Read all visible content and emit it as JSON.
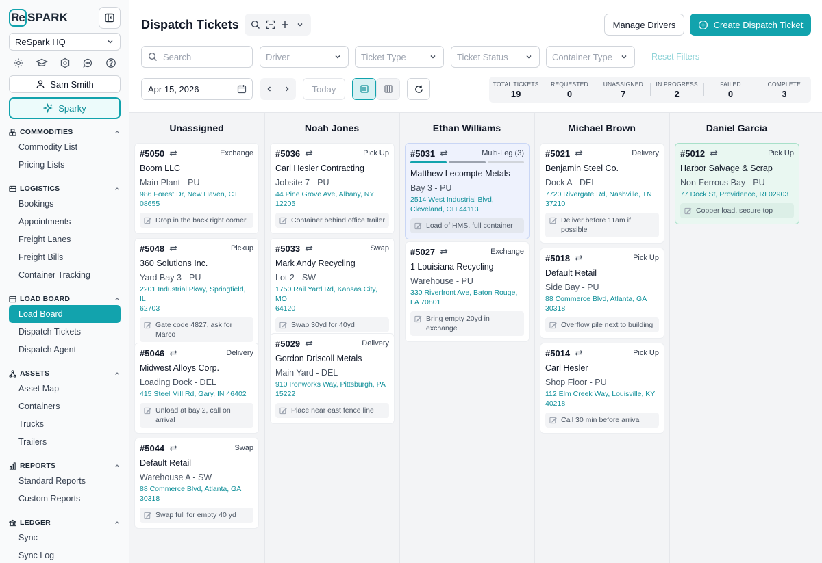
{
  "brand": {
    "logo_mark": "Re",
    "logo_text": "SPARK",
    "accent": "#12a3ad"
  },
  "org": {
    "name": "ReSpark HQ"
  },
  "user": {
    "name": "Sam Smith"
  },
  "assistant": {
    "label": "Sparky"
  },
  "icons_row": [
    "gear-icon",
    "graduation-cap-icon",
    "shield-icon",
    "chat-icon",
    "help-icon"
  ],
  "nav": {
    "commodities": {
      "title": "COMMODITIES",
      "items": [
        "Commodity List",
        "Pricing Lists"
      ]
    },
    "logistics": {
      "title": "LOGISTICS",
      "items": [
        "Bookings",
        "Appointments",
        "Freight Lanes",
        "Freight Bills",
        "Container Tracking"
      ]
    },
    "load_board": {
      "title": "LOAD BOARD",
      "items": [
        "Load Board",
        "Dispatch Tickets",
        "Dispatch Agent"
      ]
    },
    "assets": {
      "title": "ASSETS",
      "items": [
        "Asset Map",
        "Containers",
        "Trucks",
        "Trailers"
      ]
    },
    "reports": {
      "title": "REPORTS",
      "items": [
        "Standard Reports",
        "Custom Reports"
      ]
    },
    "ledger": {
      "title": "LEDGER",
      "items": [
        "Sync",
        "Sync Log"
      ]
    }
  },
  "header": {
    "title": "Dispatch Tickets",
    "manage_drivers": "Manage Drivers",
    "create_ticket": "Create Dispatch Ticket"
  },
  "filters": {
    "search_placeholder": "Search",
    "driver": "Driver",
    "ticket_type": "Ticket Type",
    "ticket_status": "Ticket Status",
    "container_type": "Container Type",
    "reset": "Reset Filters"
  },
  "toolbar": {
    "date": "Apr 15, 2026",
    "today": "Today"
  },
  "stats": [
    {
      "label": "TOTAL TICKETS",
      "value": "19"
    },
    {
      "label": "REQUESTED",
      "value": "0"
    },
    {
      "label": "UNASSIGNED",
      "value": "7"
    },
    {
      "label": "IN PROGRESS",
      "value": "2"
    },
    {
      "label": "FAILED",
      "value": "0"
    },
    {
      "label": "COMPLETE",
      "value": "3"
    }
  ],
  "columns": [
    {
      "title": "Unassigned",
      "cards": [
        {
          "num": "#5050",
          "type": "Exchange",
          "company": "Boom LLC",
          "loc": "Main Plant - PU",
          "addr": [
            "986 Forest Dr, New Haven, CT",
            "08655"
          ],
          "note": [
            "Drop in the back right corner"
          ]
        },
        {
          "num": "#5048",
          "type": "Pickup",
          "company": "360 Solutions Inc.",
          "loc": "Yard Bay 3 - PU",
          "addr": [
            "2201 Industrial Pkwy, Springfield, IL",
            "62703"
          ],
          "note": [
            "Gate code 4827, ask for",
            "Marco"
          ]
        },
        {
          "num": "#5046",
          "type": "Delivery",
          "company": "Midwest Alloys Corp.",
          "loc": "Loading Dock - DEL",
          "addr": [
            "415 Steel Mill Rd, Gary, IN 46402"
          ],
          "note": [
            "Unload at bay 2, call on",
            "arrival"
          ]
        },
        {
          "num": "#5044",
          "type": "Swap",
          "company": "Default Retail",
          "loc": "Warehouse A - SW",
          "addr": [
            "88 Commerce Blvd, Atlanta, GA",
            "30318"
          ],
          "note": [
            "Swap full for empty 40 yd"
          ]
        }
      ]
    },
    {
      "title": "Noah Jones",
      "cards": [
        {
          "num": "#5036",
          "type": "Pick Up",
          "company": "Carl Hesler Contracting",
          "loc": "Jobsite 7 - PU",
          "addr": [
            "44 Pine Grove Ave, Albany, NY",
            "12205"
          ],
          "note": [
            "Container behind office trailer"
          ]
        },
        {
          "num": "#5033",
          "type": "Swap",
          "company": "Mark Andy Recycling",
          "loc": "Lot 2 - SW",
          "addr": [
            "1750 Rail Yard Rd, Kansas City, MO",
            "64120"
          ],
          "note": [
            "Swap 30yd for 40yd"
          ]
        },
        {
          "num": "#5029",
          "type": "Delivery",
          "company": "Gordon Driscoll Metals",
          "loc": "Main Yard - DEL",
          "addr": [
            "910 Ironworks Way, Pittsburgh, PA",
            "15222"
          ],
          "note": [
            "Place near east fence line"
          ]
        }
      ]
    },
    {
      "title": "Ethan Williams",
      "cards": [
        {
          "num": "#5031",
          "type": "Multi-Leg (3)",
          "company": "Matthew Lecompte Metals",
          "loc": "Bay 3 - PU",
          "addr": [
            "2514 West Industrial Blvd,",
            "Cleveland, OH 44113"
          ],
          "note": [
            "Load of HMS, full container"
          ]
        },
        {
          "num": "#5027",
          "type": "Exchange",
          "company": "1 Louisiana Recycling",
          "loc": "Warehouse - PU",
          "addr": [
            "330 Riverfront Ave, Baton Rouge,",
            "LA 70801"
          ],
          "note": [
            "Bring empty 20yd in",
            "exchange"
          ]
        }
      ]
    },
    {
      "title": "Michael Brown",
      "cards": [
        {
          "num": "#5021",
          "type": "Delivery",
          "company": "Benjamin Steel Co.",
          "loc": "Dock A - DEL",
          "addr": [
            "7720 Rivergate Rd, Nashville, TN",
            "37210"
          ],
          "note": [
            "Deliver before 11am if",
            "possible"
          ]
        },
        {
          "num": "#5018",
          "type": "Pick Up",
          "company": "Default Retail",
          "loc": "Side Bay - PU",
          "addr": [
            "88 Commerce Blvd, Atlanta, GA",
            "30318"
          ],
          "note": [
            "Overflow pile next to building"
          ]
        },
        {
          "num": "#5014",
          "type": "Pick Up",
          "company": "Carl Hesler",
          "loc": "Shop Floor - PU",
          "addr": [
            "112 Elm Creek Way, Louisville, KY",
            "40218"
          ],
          "note": [
            "Call 30 min before arrival"
          ]
        }
      ]
    },
    {
      "title": "Daniel Garcia",
      "cards": [
        {
          "num": "#5012",
          "type": "Pick Up",
          "company": "Harbor Salvage & Scrap",
          "loc": "Non-Ferrous Bay - PU",
          "addr": [
            "77 Dock St, Providence, RI 02903"
          ],
          "note": [
            "Copper load, secure top"
          ]
        }
      ]
    }
  ],
  "colors": {
    "in_progress_card": "#eef2fd",
    "complete_card": "#e9f7f1",
    "leg_done": "#12a3ad",
    "leg_pending": "#9ca3af"
  }
}
